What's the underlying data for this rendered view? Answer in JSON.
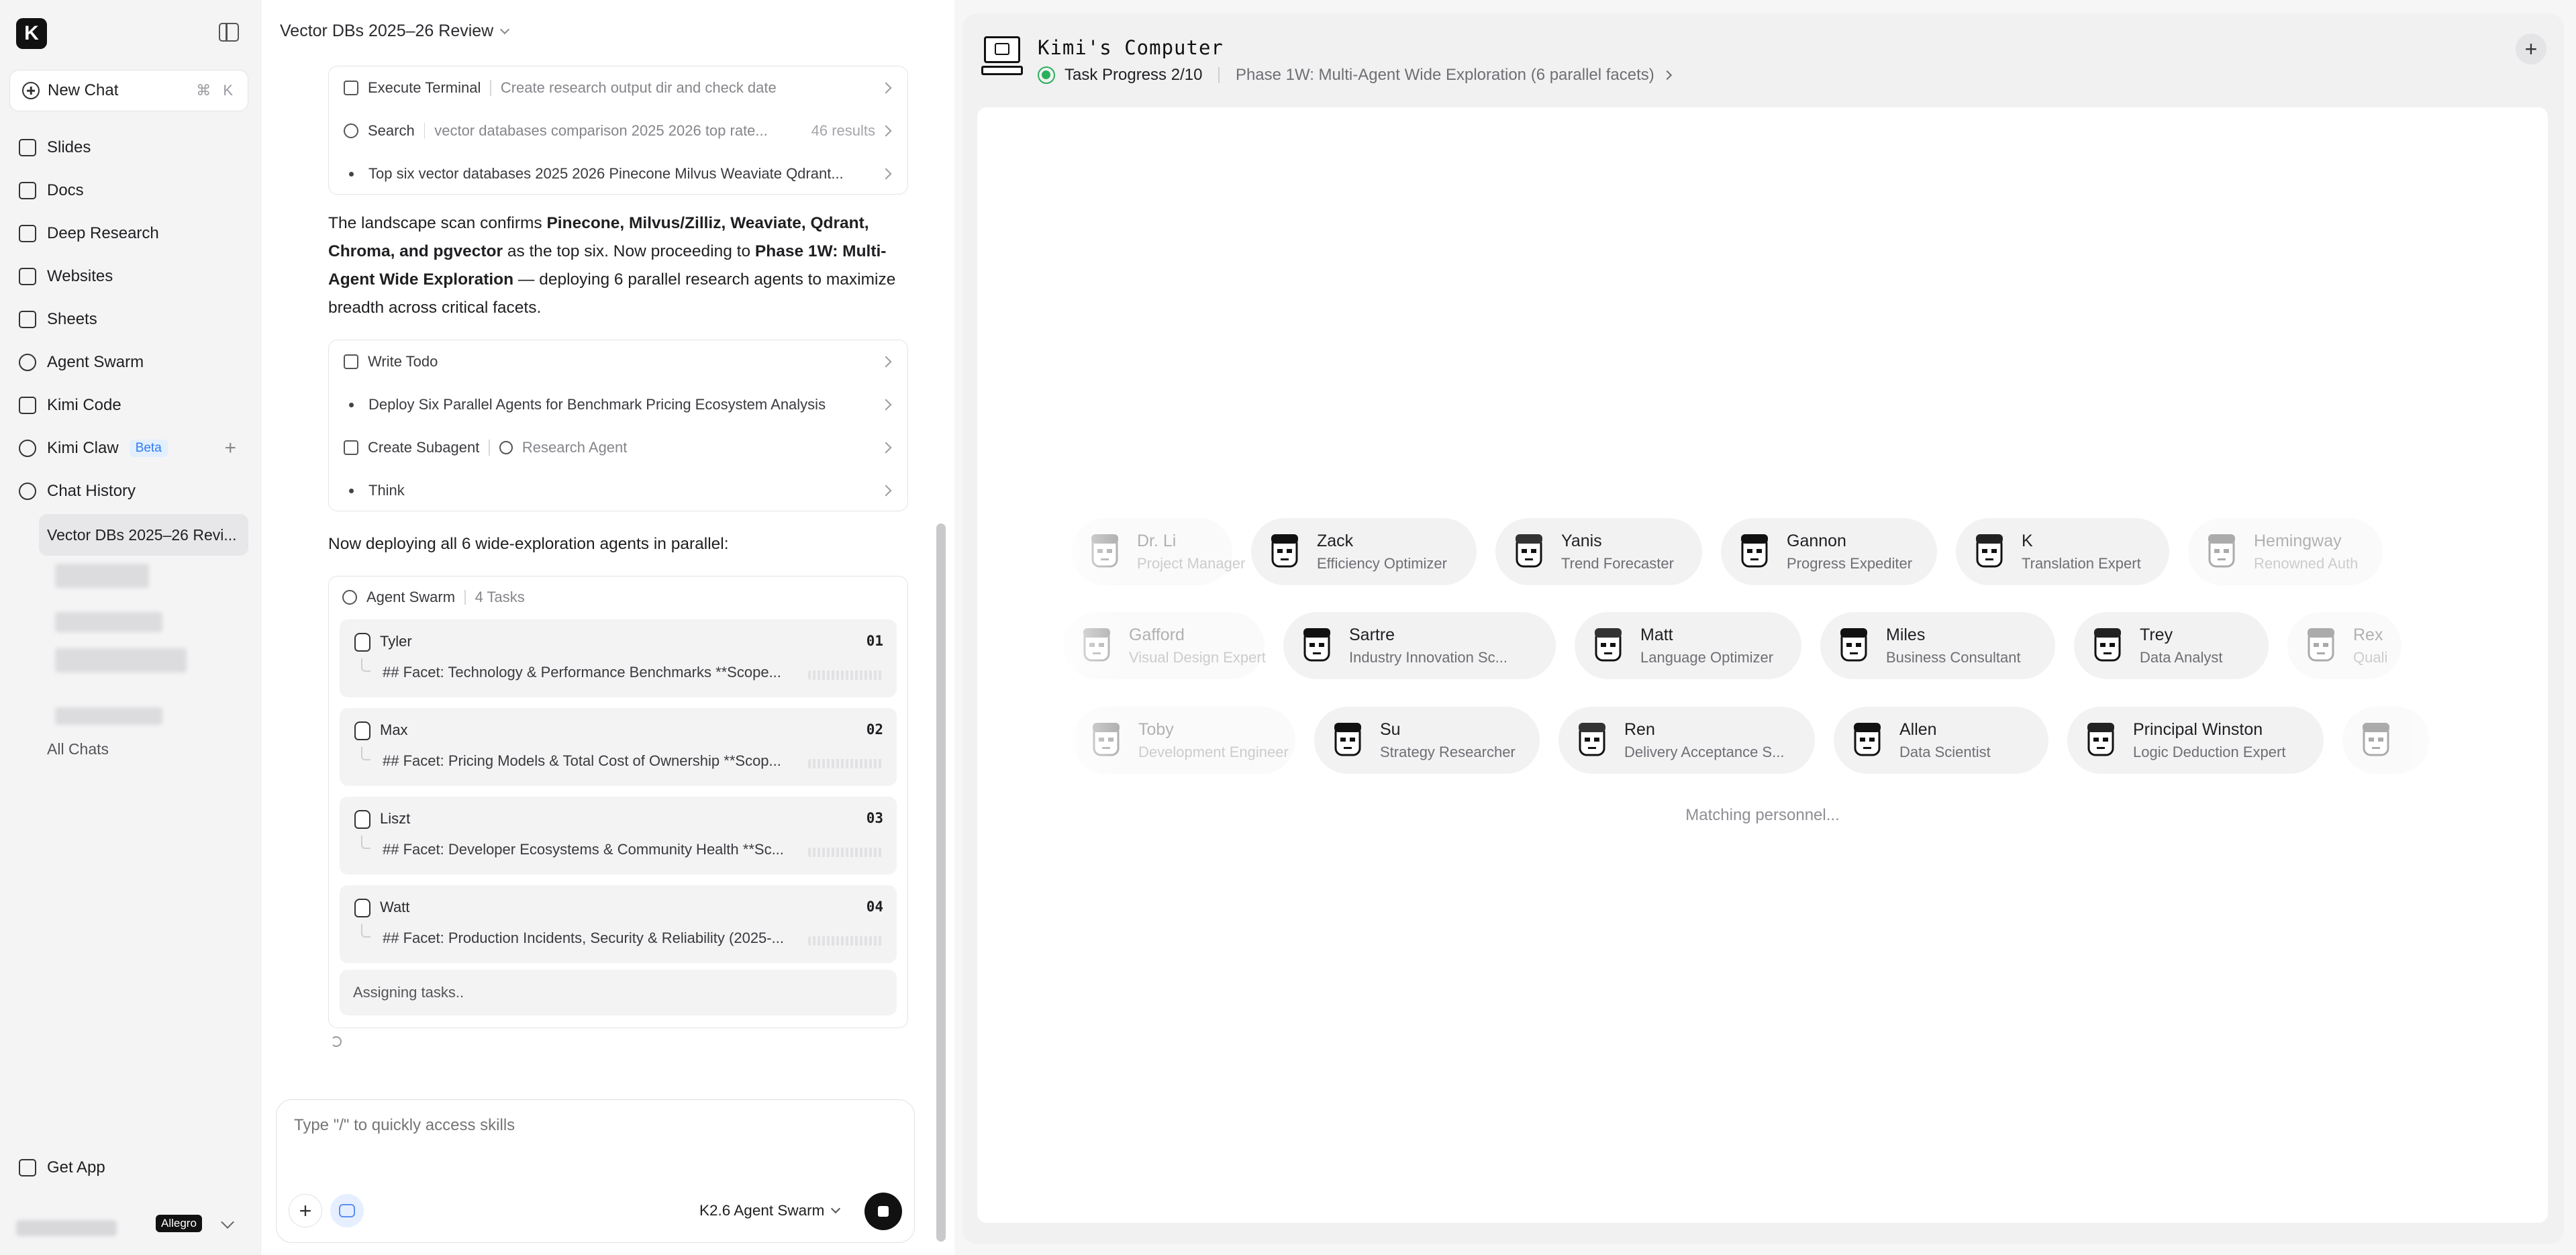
{
  "sidebar": {
    "logo": "K",
    "new_chat": {
      "label": "New Chat",
      "shortcut": "⌘ K"
    },
    "items": [
      {
        "label": "Slides",
        "icon": "slides-icon"
      },
      {
        "label": "Docs",
        "icon": "docs-icon"
      },
      {
        "label": "Deep Research",
        "icon": "deep-research-icon"
      },
      {
        "label": "Websites",
        "icon": "websites-icon"
      },
      {
        "label": "Sheets",
        "icon": "sheets-icon"
      },
      {
        "label": "Agent Swarm",
        "icon": "agent-swarm-icon"
      },
      {
        "label": "Kimi Code",
        "icon": "terminal-icon"
      },
      {
        "label": "Kimi Claw",
        "icon": "claw-icon",
        "badge": "Beta"
      },
      {
        "label": "Chat History",
        "icon": "clock-icon"
      }
    ],
    "active_chat": "Vector DBs 2025–26 Revi...",
    "all_chats": "All Chats",
    "get_app": "Get App",
    "plan_tag": "Allegro"
  },
  "chat": {
    "title": "Vector DBs 2025–26 Review",
    "tool_box_1": {
      "rows": [
        {
          "tool": "Execute Terminal",
          "detail": "Create research output dir and check date",
          "icon": "terminal-icon"
        },
        {
          "tool": "Search",
          "detail": "vector databases comparison 2025 2026 top rate...",
          "count": "46 results",
          "icon": "search-icon"
        },
        {
          "detail": "Top six vector databases 2025 2026 Pinecone Milvus Weaviate Qdrant..."
        }
      ]
    },
    "paragraph_1": {
      "p1": "The landscape scan confirms ",
      "b1": "Pinecone, Milvus/Zilliz, Weaviate, Qdrant, Chroma, and pgvector",
      "p2": " as the top six. Now proceeding to ",
      "b2": "Phase 1W: Multi-Agent Wide Exploration",
      "p3": " — deploying 6 parallel research agents to maximize breadth across critical facets."
    },
    "tool_box_2": {
      "rows": [
        {
          "tool": "Write Todo",
          "icon": "todo-icon"
        },
        {
          "detail": "Deploy Six Parallel Agents for Benchmark Pricing Ecosystem Analysis"
        },
        {
          "tool": "Create Subagent",
          "detail": "Research Agent",
          "icon": "subagent-icon"
        },
        {
          "detail": "Think"
        }
      ]
    },
    "paragraph_2": "Now deploying all 6 wide-exploration agents in parallel:",
    "swarm": {
      "title": "Agent Swarm",
      "count": "4 Tasks",
      "agents": [
        {
          "name": "Tyler",
          "num": "01",
          "facet": "## Facet: Technology & Performance Benchmarks **Scope..."
        },
        {
          "name": "Max",
          "num": "02",
          "facet": "## Facet: Pricing Models & Total Cost of Ownership **Scop..."
        },
        {
          "name": "Liszt",
          "num": "03",
          "facet": "## Facet: Developer Ecosystems & Community Health **Sc..."
        },
        {
          "name": "Watt",
          "num": "04",
          "facet": "## Facet: Production Incidents, Security & Reliability (2025-..."
        }
      ],
      "status": "Assigning tasks.."
    },
    "composer": {
      "placeholder": "Type \"/\" to quickly access skills",
      "model": "K2.6 Agent Swarm"
    }
  },
  "computer": {
    "title": "Kimi's Computer",
    "progress": "Task Progress 2/10",
    "progress_value": 0.2,
    "phase": "Phase 1W: Multi-Agent Wide Exploration (6 parallel facets)",
    "rows": [
      [
        {
          "name": "Dr. Li",
          "role": "Project Manager",
          "fade": true
        },
        {
          "name": "Zack",
          "role": "Efficiency Optimizer"
        },
        {
          "name": "Yanis",
          "role": "Trend Forecaster"
        },
        {
          "name": "Gannon",
          "role": "Progress Expediter"
        },
        {
          "name": "K",
          "role": "Translation Expert"
        },
        {
          "name": "Hemingway",
          "role": "Renowned Auth",
          "fade": true
        }
      ],
      [
        {
          "name": "Gafford",
          "role": "Visual Design Expert",
          "fade": true
        },
        {
          "name": "Sartre",
          "role": "Industry Innovation Sc..."
        },
        {
          "name": "Matt",
          "role": "Language Optimizer"
        },
        {
          "name": "Miles",
          "role": "Business Consultant"
        },
        {
          "name": "Trey",
          "role": "Data Analyst"
        },
        {
          "name": "Rex",
          "role": "Quali",
          "fade": true
        }
      ],
      [
        {
          "name": "Toby",
          "role": "Development Engineer",
          "fade": true
        },
        {
          "name": "Su",
          "role": "Strategy Researcher"
        },
        {
          "name": "Ren",
          "role": "Delivery Acceptance S..."
        },
        {
          "name": "Allen",
          "role": "Data Scientist"
        },
        {
          "name": "Principal Winston",
          "role": "Logic Deduction Expert"
        },
        {
          "name": "",
          "role": "",
          "fade": true
        }
      ]
    ],
    "status": "Matching personnel..."
  }
}
